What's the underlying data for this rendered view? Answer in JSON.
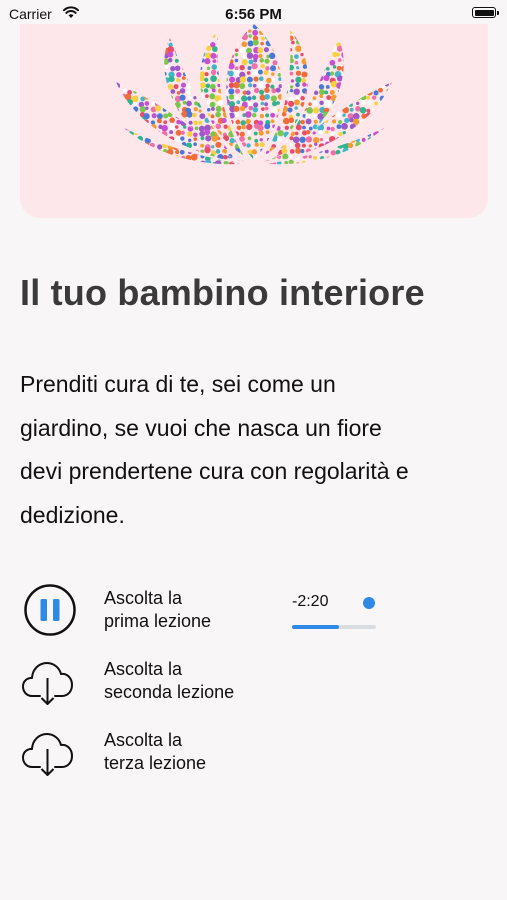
{
  "status_bar": {
    "carrier": "Carrier",
    "time": "6:56 PM",
    "battery_level": 1.0
  },
  "header": {
    "image": "lotus-mosaic-illustration"
  },
  "title": "Il tuo bambino interiore",
  "description_lines": [
    "Prenditi cura di te, sei come un",
    "giardino, se vuoi che nasca un fiore",
    "devi prendertene cura con regolarità e",
    "dedizione."
  ],
  "lessons": [
    {
      "line1": "Ascolta la",
      "line2": "prima lezione",
      "icon": "pause-icon",
      "state": "playing"
    },
    {
      "line1": "Ascolta la",
      "line2": "seconda lezione",
      "icon": "cloud-download-icon",
      "state": "not-downloaded"
    },
    {
      "line1": "Ascolta la",
      "line2": "terza lezione",
      "icon": "cloud-download-icon",
      "state": "not-downloaded"
    }
  ],
  "player": {
    "remaining": "-2:20",
    "progress": 0.56
  },
  "colors": {
    "accent": "#2f8ae5",
    "hero_bg": "#fde7ea",
    "title": "#3a3a3a",
    "background": "#f8f6f7"
  }
}
